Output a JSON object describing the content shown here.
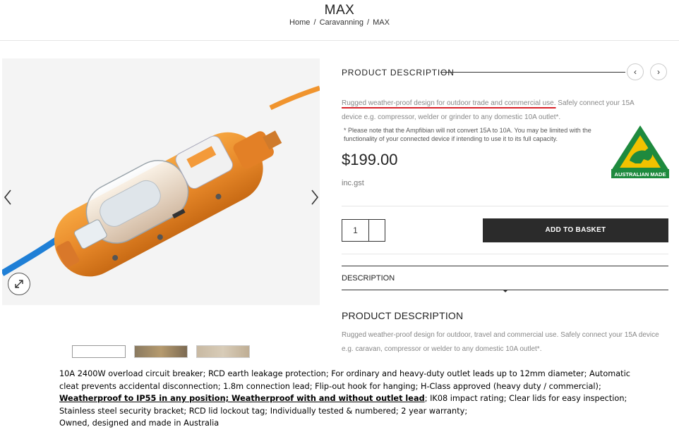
{
  "header": {
    "title": "MAX",
    "breadcrumb": [
      "Home",
      "/",
      "Caravanning",
      "/",
      "MAX"
    ]
  },
  "gallery": {
    "prev_icon": "chevron-left-icon",
    "next_icon": "chevron-right-icon",
    "zoom_icon": "expand-icon"
  },
  "product": {
    "section_heading": "PRODUCT DESCRIPTION",
    "desc_underlined": "Rugged weather-proof design for outdoor trade and commercial use.",
    "desc_rest": " Safely connect your 15A device e.g. compressor, welder or grinder to any domestic 10A outlet*.",
    "note": "* Please note that the Ampfibian will not convert 15A to 10A. You may be limited with the functionality of your connected device if intending to use it to its full capacity.",
    "price": "$199.00",
    "gst": "inc.gst",
    "logo_text": "AUSTRALIAN MADE",
    "quantity": "1",
    "add_to_basket": "ADD TO BASKET"
  },
  "tabs": {
    "description": "DESCRIPTION"
  },
  "description_section": {
    "heading": "PRODUCT DESCRIPTION",
    "text": "Rugged weather-proof design for outdoor, travel and commercial use. Safely connect your 15A device e.g. caravan, compressor or welder to any domestic 10A outlet*."
  },
  "caption": {
    "part1": "10A 2400W  overload circuit  breaker; RCD earth leakage protection; For ordinary and heavy-duty outlet leads up to 12mm diameter; Automatic cleat prevents accidental disconnection; 1.8m connection lead; Flip-out hook for hanging; H-Class approved (heavy duty / commercial);  ",
    "bold_underlined": "Weatherproof to IP55 in any position; Weatherproof with and without outlet lead",
    "part2": "; IK08 impact rating;  Clear lids for easy inspection; Stainless steel security bracket; RCD lid lockout tag; Individually tested & numbered; 2 year warranty;",
    "part3": "Owned, designed and made in Australia"
  },
  "colors": {
    "accent_red": "#d8232a",
    "button_dark": "#2b2b2b",
    "product_orange": "#e8892a",
    "cable_blue": "#1f7fd6",
    "logo_green": "#1e8a3e",
    "logo_gold": "#f2c200"
  }
}
